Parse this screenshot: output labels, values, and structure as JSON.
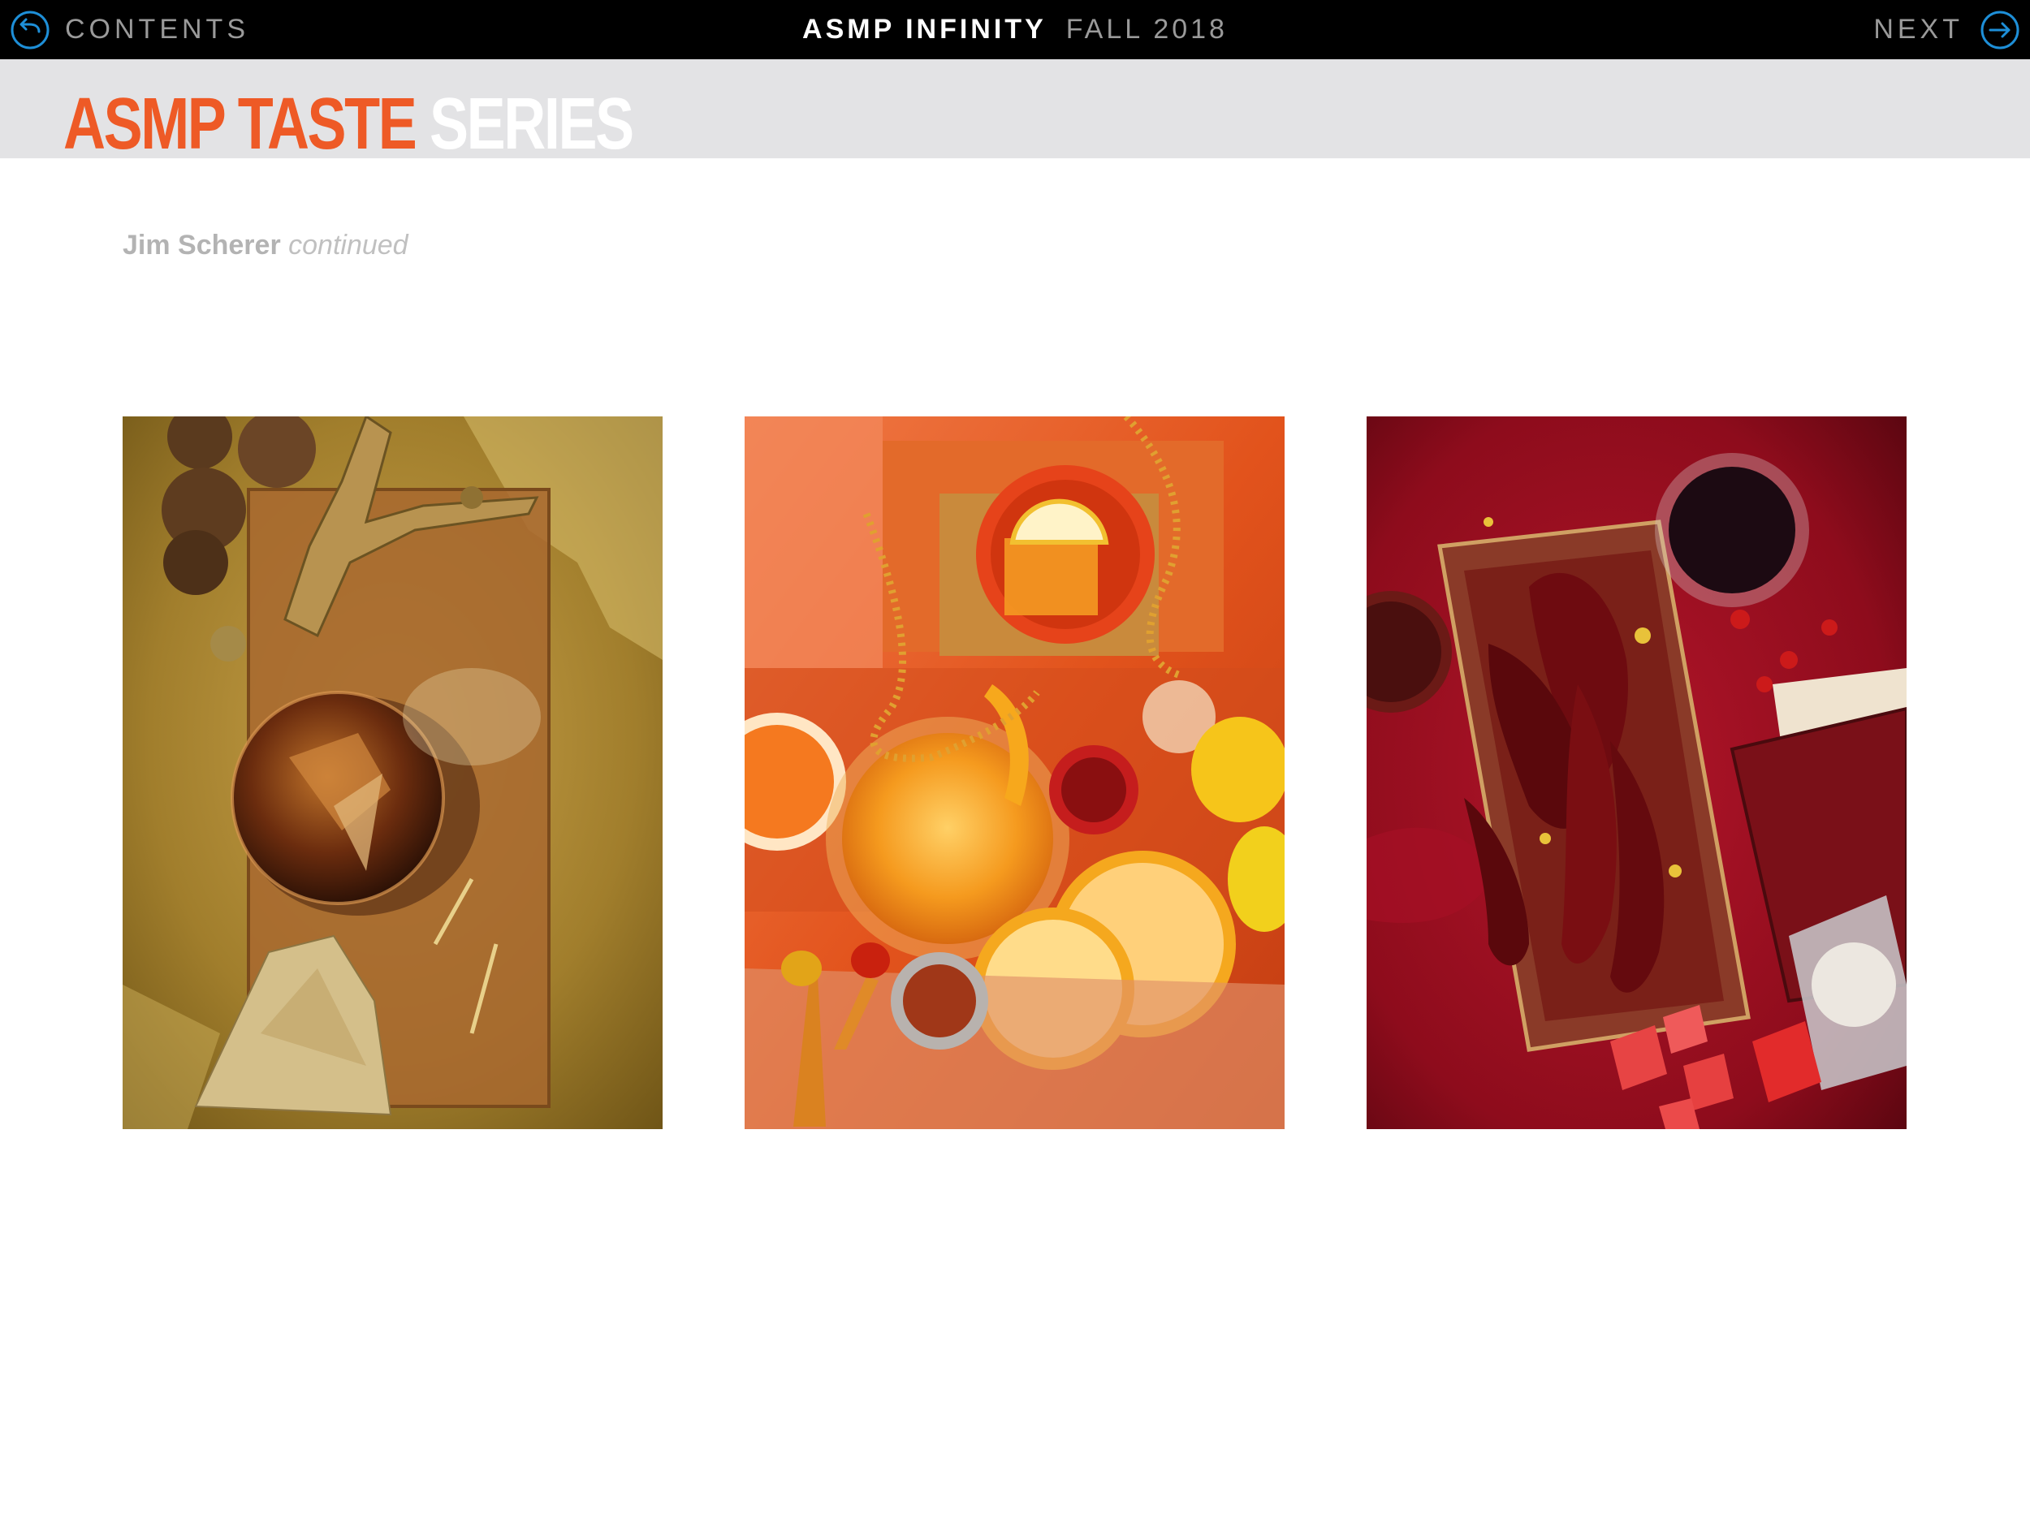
{
  "nav": {
    "back_label": "CONTENTS",
    "next_label": "NEXT",
    "publication": "ASMP INFINITY",
    "issue": "FALL 2018"
  },
  "header": {
    "title_accent": "ASMP TASTE",
    "title_light": "SERIES"
  },
  "byline": {
    "name": "Jim Scherer",
    "suffix": "continued"
  },
  "photos": [
    {
      "subject": "golden nutcracker, walnuts, whiskey glass, darts and bay leaves",
      "dominant_color": "#b08a34"
    },
    {
      "subject": "orange cocktail with citrus slices, spices and beads",
      "dominant_color": "#e2551c"
    },
    {
      "subject": "dried red chilies on board, wine glass, stamps and ashtray",
      "dominant_color": "#a3111f"
    }
  ],
  "colors": {
    "topbar": "#000000",
    "header_band": "#e3e3e5",
    "title_accent": "#ee5a26",
    "nav_icon": "#1e8fd8"
  },
  "icons": {
    "back": "circle-arrow-left-icon",
    "next": "circle-arrow-right-icon"
  }
}
